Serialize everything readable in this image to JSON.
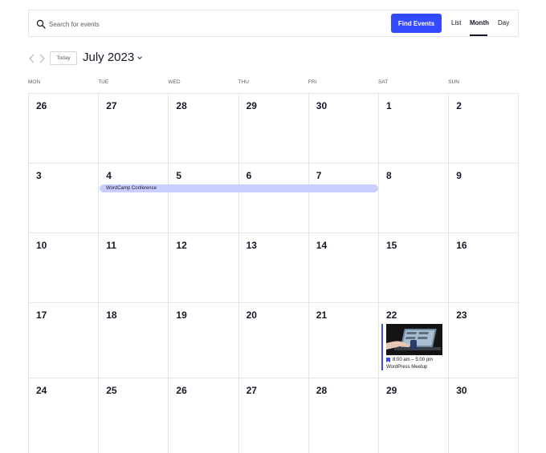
{
  "search": {
    "placeholder": "Search for events",
    "button_label": "Find Events"
  },
  "views": {
    "list": "List",
    "month": "Month",
    "day": "Day",
    "active": "Month"
  },
  "nav": {
    "today_label": "Today",
    "month_title": "July 2023"
  },
  "days_of_week": [
    "MON",
    "TUE",
    "WED",
    "THU",
    "FRI",
    "SAT",
    "SUN"
  ],
  "weeks": [
    [
      "26",
      "27",
      "28",
      "29",
      "30",
      "1",
      "2"
    ],
    [
      "3",
      "4",
      "5",
      "6",
      "7",
      "8",
      "9"
    ],
    [
      "10",
      "11",
      "12",
      "13",
      "14",
      "15",
      "16"
    ],
    [
      "17",
      "18",
      "19",
      "20",
      "21",
      "22",
      "23"
    ],
    [
      "24",
      "25",
      "26",
      "27",
      "28",
      "29",
      "30"
    ]
  ],
  "events": {
    "multiday": {
      "title": "WordCamp Conference"
    },
    "meetup": {
      "time": "8:00 am – 5:00 pm",
      "title": "WordPress Meetup"
    }
  },
  "colors": {
    "accent": "#334aff",
    "multiday_bg": "#c9ceff",
    "grid_line": "#e4e4e4",
    "text": "#141827"
  }
}
